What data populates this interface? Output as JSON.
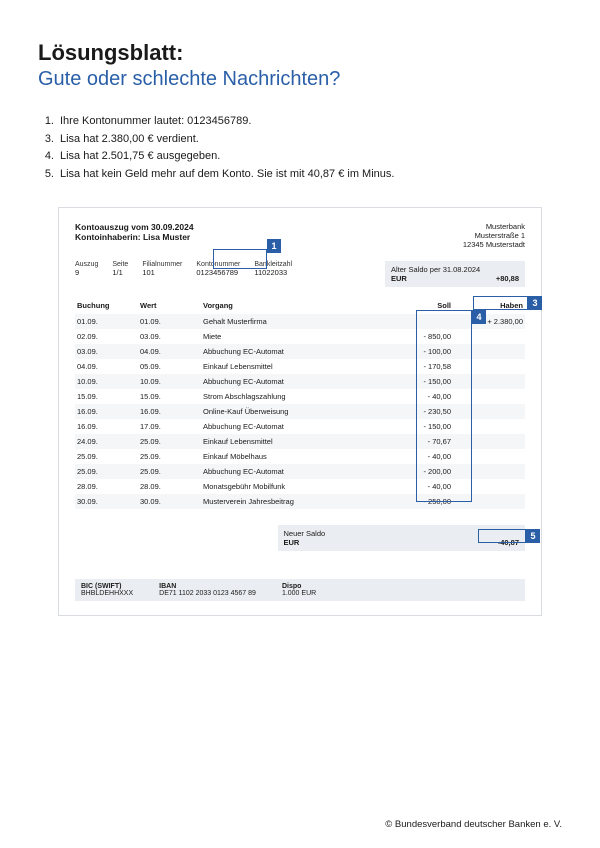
{
  "header": {
    "title": "Lösungsblatt:",
    "subtitle": "Gute oder schlechte Nachrichten?"
  },
  "answers": [
    {
      "num": "1.",
      "text": "Ihre Kontonummer lautet: 0123456789."
    },
    {
      "num": "3.",
      "text": "Lisa hat 2.380,00 € verdient."
    },
    {
      "num": "4.",
      "text": "Lisa hat 2.501,75 € ausgegeben."
    },
    {
      "num": "5.",
      "text": "Lisa hat kein Geld mehr auf dem Konto. Sie ist mit 40,87 € im Minus."
    }
  ],
  "statement": {
    "title1": "Kontoauszug vom 30.09.2024",
    "title2": "Kontoinhaberin: Lisa Muster",
    "bank": {
      "name": "Musterbank",
      "street": "Musterstraße 1",
      "city": "12345 Musterstadt"
    },
    "meta": {
      "auszug": {
        "lbl": "Auszug",
        "val": "9"
      },
      "seite": {
        "lbl": "Seite",
        "val": "1/1"
      },
      "filial": {
        "lbl": "Filialnummer",
        "val": "101"
      },
      "konto": {
        "lbl": "Kontonummer",
        "val": "0123456789"
      },
      "blz": {
        "lbl": "Bankleitzahl",
        "val": "11022033"
      }
    },
    "alter_saldo": {
      "label": "Alter Saldo per 31.08.2024",
      "currency": "EUR",
      "value": "+80,88"
    },
    "columns": {
      "buchung": "Buchung",
      "wert": "Wert",
      "vorgang": "Vorgang",
      "soll": "Soll",
      "haben": "Haben"
    },
    "tx": [
      {
        "b": "01.09.",
        "w": "01.09.",
        "v": "Gehalt Musterfirma",
        "s": "",
        "h": "+ 2.380,00"
      },
      {
        "b": "02.09.",
        "w": "03.09.",
        "v": "Miete",
        "s": "- 850,00",
        "h": ""
      },
      {
        "b": "03.09.",
        "w": "04.09.",
        "v": "Abbuchung EC-Automat",
        "s": "- 100,00",
        "h": ""
      },
      {
        "b": "04.09.",
        "w": "05.09.",
        "v": "Einkauf Lebensmittel",
        "s": "- 170,58",
        "h": ""
      },
      {
        "b": "10.09.",
        "w": "10.09.",
        "v": "Abbuchung EC-Automat",
        "s": "- 150,00",
        "h": ""
      },
      {
        "b": "15.09.",
        "w": "15.09.",
        "v": "Strom Abschlagszahlung",
        "s": "- 40,00",
        "h": ""
      },
      {
        "b": "16.09.",
        "w": "16.09.",
        "v": "Online-Kauf Überweisung",
        "s": "- 230,50",
        "h": ""
      },
      {
        "b": "16.09.",
        "w": "17.09.",
        "v": "Abbuchung EC-Automat",
        "s": "- 150,00",
        "h": ""
      },
      {
        "b": "24.09.",
        "w": "25.09.",
        "v": "Einkauf Lebensmittel",
        "s": "- 70,67",
        "h": ""
      },
      {
        "b": "25.09.",
        "w": "25.09.",
        "v": "Einkauf Möbelhaus",
        "s": "- 40,00",
        "h": ""
      },
      {
        "b": "25.09.",
        "w": "25.09.",
        "v": "Abbuchung EC-Automat",
        "s": "- 200,00",
        "h": ""
      },
      {
        "b": "28.09.",
        "w": "28.09.",
        "v": "Monatsgebühr Mobilfunk",
        "s": "- 40,00",
        "h": ""
      },
      {
        "b": "30.09.",
        "w": "30.09.",
        "v": "Musterverein Jahresbeitrag",
        "s": "- 250,00",
        "h": ""
      }
    ],
    "neuer_saldo": {
      "label": "Neuer Saldo",
      "currency": "EUR",
      "value": "-40,87"
    },
    "footer": {
      "bic": {
        "lbl": "BIC (SWIFT)",
        "val": "BHBLDEHHXXX"
      },
      "iban": {
        "lbl": "IBAN",
        "val": "DE71 1102 2033 0123 4567 89"
      },
      "dispo": {
        "lbl": "Dispo",
        "val": "1.000 EUR"
      }
    }
  },
  "callouts": {
    "c1": "1",
    "c3": "3",
    "c4": "4",
    "c5": "5"
  },
  "copyright": "© Bundesverband deutscher Banken e. V."
}
